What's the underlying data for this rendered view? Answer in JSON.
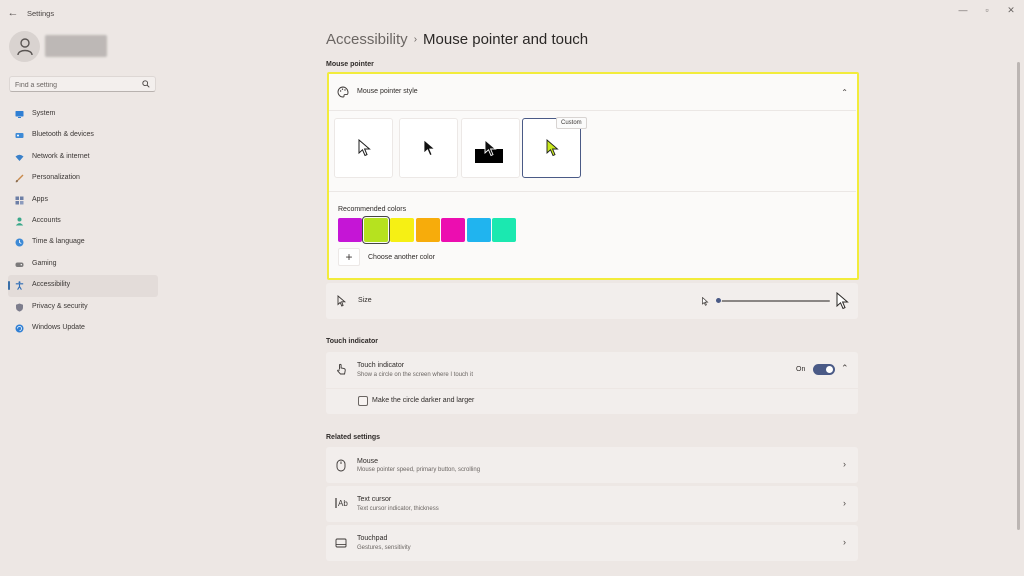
{
  "window": {
    "title": "Settings",
    "back_icon": "back-arrow-icon"
  },
  "sidebar": {
    "search_placeholder": "Find a setting",
    "items": [
      {
        "label": "System",
        "icon": "monitor-icon",
        "color": "#2f7fd4"
      },
      {
        "label": "Bluetooth & devices",
        "icon": "bluetooth-icon",
        "color": "#3d8ad6"
      },
      {
        "label": "Network & internet",
        "icon": "wifi-icon",
        "color": "#3a80c9"
      },
      {
        "label": "Personalization",
        "icon": "brush-icon",
        "color": "#c9894a"
      },
      {
        "label": "Apps",
        "icon": "apps-icon",
        "color": "#6d7fa6"
      },
      {
        "label": "Accounts",
        "icon": "person-icon",
        "color": "#3aa88a"
      },
      {
        "label": "Time & language",
        "icon": "globe-clock-icon",
        "color": "#3d8ad6"
      },
      {
        "label": "Gaming",
        "icon": "gamepad-icon",
        "color": "#7c7a7a"
      },
      {
        "label": "Accessibility",
        "icon": "accessibility-icon",
        "color": "#2c6bb5"
      },
      {
        "label": "Privacy & security",
        "icon": "shield-icon",
        "color": "#7d7d8c"
      },
      {
        "label": "Windows Update",
        "icon": "update-icon",
        "color": "#2f7fd4"
      }
    ],
    "active_index": 8
  },
  "header": {
    "parent": "Accessibility",
    "separator": "›",
    "current": "Mouse pointer and touch"
  },
  "mouse_pointer": {
    "section_label": "Mouse pointer",
    "style": {
      "title": "Mouse pointer style",
      "options": [
        "white-pointer-icon",
        "black-pointer-icon",
        "inverted-pointer-icon",
        "custom-pointer-icon"
      ],
      "selected_index": 3,
      "tooltip": "Custom",
      "custom_color": "#c8e81e"
    },
    "recommended_colors_label": "Recommended colors",
    "colors": [
      "#c515d6",
      "#b6e21f",
      "#f6f014",
      "#f7ac0b",
      "#ec0db0",
      "#20b4ef",
      "#1be8b0"
    ],
    "selected_color_index": 1,
    "choose_color_label": "Choose another color",
    "size": {
      "label": "Size",
      "value": 0.0
    }
  },
  "touch": {
    "section_label": "Touch indicator",
    "title": "Touch indicator",
    "subtitle": "Show a circle on the screen where I touch it",
    "state": "On",
    "checkbox_label": "Make the circle darker and larger",
    "checkbox_checked": false
  },
  "related": {
    "section_label": "Related settings",
    "items": [
      {
        "title": "Mouse",
        "subtitle": "Mouse pointer speed, primary button, scrolling",
        "icon": "mouse-icon"
      },
      {
        "title": "Text cursor",
        "subtitle": "Text cursor indicator, thickness",
        "icon": "text-cursor-icon"
      },
      {
        "title": "Touchpad",
        "subtitle": "Gestures, sensitivity",
        "icon": "touchpad-icon"
      }
    ]
  }
}
